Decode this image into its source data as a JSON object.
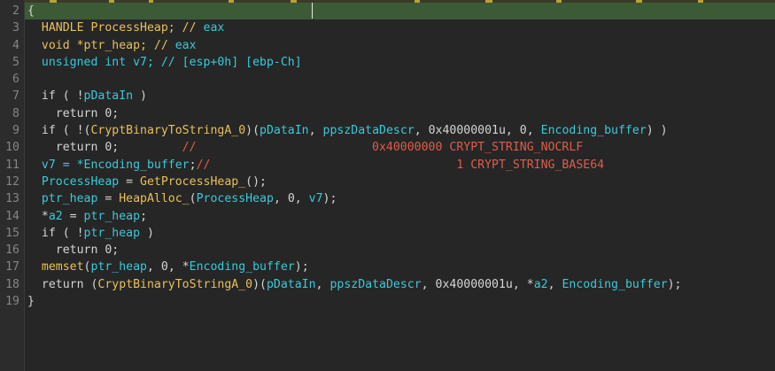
{
  "editor": {
    "lines": [
      {
        "num": "2",
        "tokens": [
          {
            "t": "{",
            "k": "w"
          }
        ]
      },
      {
        "num": "3",
        "tokens": [
          {
            "t": "  HANDLE ProcessHeap; // ",
            "k": "y"
          },
          {
            "t": "eax",
            "k": "c"
          }
        ]
      },
      {
        "num": "4",
        "tokens": [
          {
            "t": "  void *ptr_heap; // ",
            "k": "y"
          },
          {
            "t": "eax",
            "k": "c"
          }
        ]
      },
      {
        "num": "5",
        "tokens": [
          {
            "t": "  unsigned int v7; // ",
            "k": "c"
          },
          {
            "t": "[esp+0h] [ebp-Ch]",
            "k": "c"
          }
        ]
      },
      {
        "num": "6",
        "tokens": []
      },
      {
        "num": "7",
        "tokens": [
          {
            "t": "  if ( !",
            "k": "w"
          },
          {
            "t": "pDataIn",
            "k": "c"
          },
          {
            "t": " )",
            "k": "w"
          }
        ]
      },
      {
        "num": "8",
        "tokens": [
          {
            "t": "    return 0;",
            "k": "w"
          }
        ]
      },
      {
        "num": "9",
        "tokens": [
          {
            "t": "  if ( !(",
            "k": "w"
          },
          {
            "t": "CryptBinaryToStringA_0",
            "k": "y"
          },
          {
            "t": ")(",
            "k": "w"
          },
          {
            "t": "pDataIn",
            "k": "c"
          },
          {
            "t": ", ",
            "k": "w"
          },
          {
            "t": "ppszDataDescr",
            "k": "c"
          },
          {
            "t": ", 0x40000001u, 0, ",
            "k": "w"
          },
          {
            "t": "Encoding_buffer",
            "k": "c"
          },
          {
            "t": ") )",
            "k": "w"
          }
        ]
      },
      {
        "num": "10",
        "tokens": [
          {
            "t": "    return 0;         ",
            "k": "w"
          },
          {
            "t": "//                         0x40000000 CRYPT_STRING_NOCRLF",
            "k": "r"
          }
        ]
      },
      {
        "num": "11",
        "tokens": [
          {
            "t": "  v7 = *",
            "k": "c"
          },
          {
            "t": "Encoding_buffer",
            "k": "c"
          },
          {
            "t": ";",
            "k": "w"
          },
          {
            "t": "//                                   1 CRYPT_STRING_BASE64",
            "k": "r"
          }
        ]
      },
      {
        "num": "12",
        "tokens": [
          {
            "t": "  ProcessHeap",
            "k": "c"
          },
          {
            "t": " = ",
            "k": "w"
          },
          {
            "t": "GetProcessHeap_",
            "k": "y"
          },
          {
            "t": "();",
            "k": "w"
          }
        ]
      },
      {
        "num": "13",
        "tokens": [
          {
            "t": "  ptr_heap",
            "k": "c"
          },
          {
            "t": " = ",
            "k": "w"
          },
          {
            "t": "HeapAlloc_",
            "k": "y"
          },
          {
            "t": "(",
            "k": "w"
          },
          {
            "t": "ProcessHeap",
            "k": "c"
          },
          {
            "t": ", 0, ",
            "k": "w"
          },
          {
            "t": "v7",
            "k": "c"
          },
          {
            "t": ");",
            "k": "w"
          }
        ]
      },
      {
        "num": "14",
        "tokens": [
          {
            "t": "  *",
            "k": "w"
          },
          {
            "t": "a2",
            "k": "c"
          },
          {
            "t": " = ",
            "k": "w"
          },
          {
            "t": "ptr_heap",
            "k": "c"
          },
          {
            "t": ";",
            "k": "w"
          }
        ]
      },
      {
        "num": "15",
        "tokens": [
          {
            "t": "  if ( !",
            "k": "w"
          },
          {
            "t": "ptr_heap",
            "k": "c"
          },
          {
            "t": " )",
            "k": "w"
          }
        ]
      },
      {
        "num": "16",
        "tokens": [
          {
            "t": "    return 0;",
            "k": "w"
          }
        ]
      },
      {
        "num": "17",
        "tokens": [
          {
            "t": "  ",
            "k": "w"
          },
          {
            "t": "memset",
            "k": "y"
          },
          {
            "t": "(",
            "k": "w"
          },
          {
            "t": "ptr_heap",
            "k": "c"
          },
          {
            "t": ", 0, *",
            "k": "w"
          },
          {
            "t": "Encoding_buffer",
            "k": "c"
          },
          {
            "t": ");",
            "k": "w"
          }
        ]
      },
      {
        "num": "18",
        "tokens": [
          {
            "t": "  return (",
            "k": "w"
          },
          {
            "t": "CryptBinaryToStringA_0",
            "k": "y"
          },
          {
            "t": ")(",
            "k": "w"
          },
          {
            "t": "pDataIn",
            "k": "c"
          },
          {
            "t": ", ",
            "k": "w"
          },
          {
            "t": "ppszDataDescr",
            "k": "c"
          },
          {
            "t": ", 0x40000001u, *",
            "k": "w"
          },
          {
            "t": "a2",
            "k": "c"
          },
          {
            "t": ", ",
            "k": "w"
          },
          {
            "t": "Encoding_buffer",
            "k": "c"
          },
          {
            "t": ");",
            "k": "w"
          }
        ]
      },
      {
        "num": "19",
        "tokens": [
          {
            "t": "}",
            "k": "w"
          }
        ]
      }
    ]
  },
  "colors": {
    "background": "#262626",
    "gutter": "#2c2c2c",
    "current_line": "#3d5a37",
    "identifier_yellow": "#e8c05a",
    "identifier_cyan": "#3cc8d8",
    "comment_red": "#e05c4a",
    "line_number": "#858585"
  }
}
